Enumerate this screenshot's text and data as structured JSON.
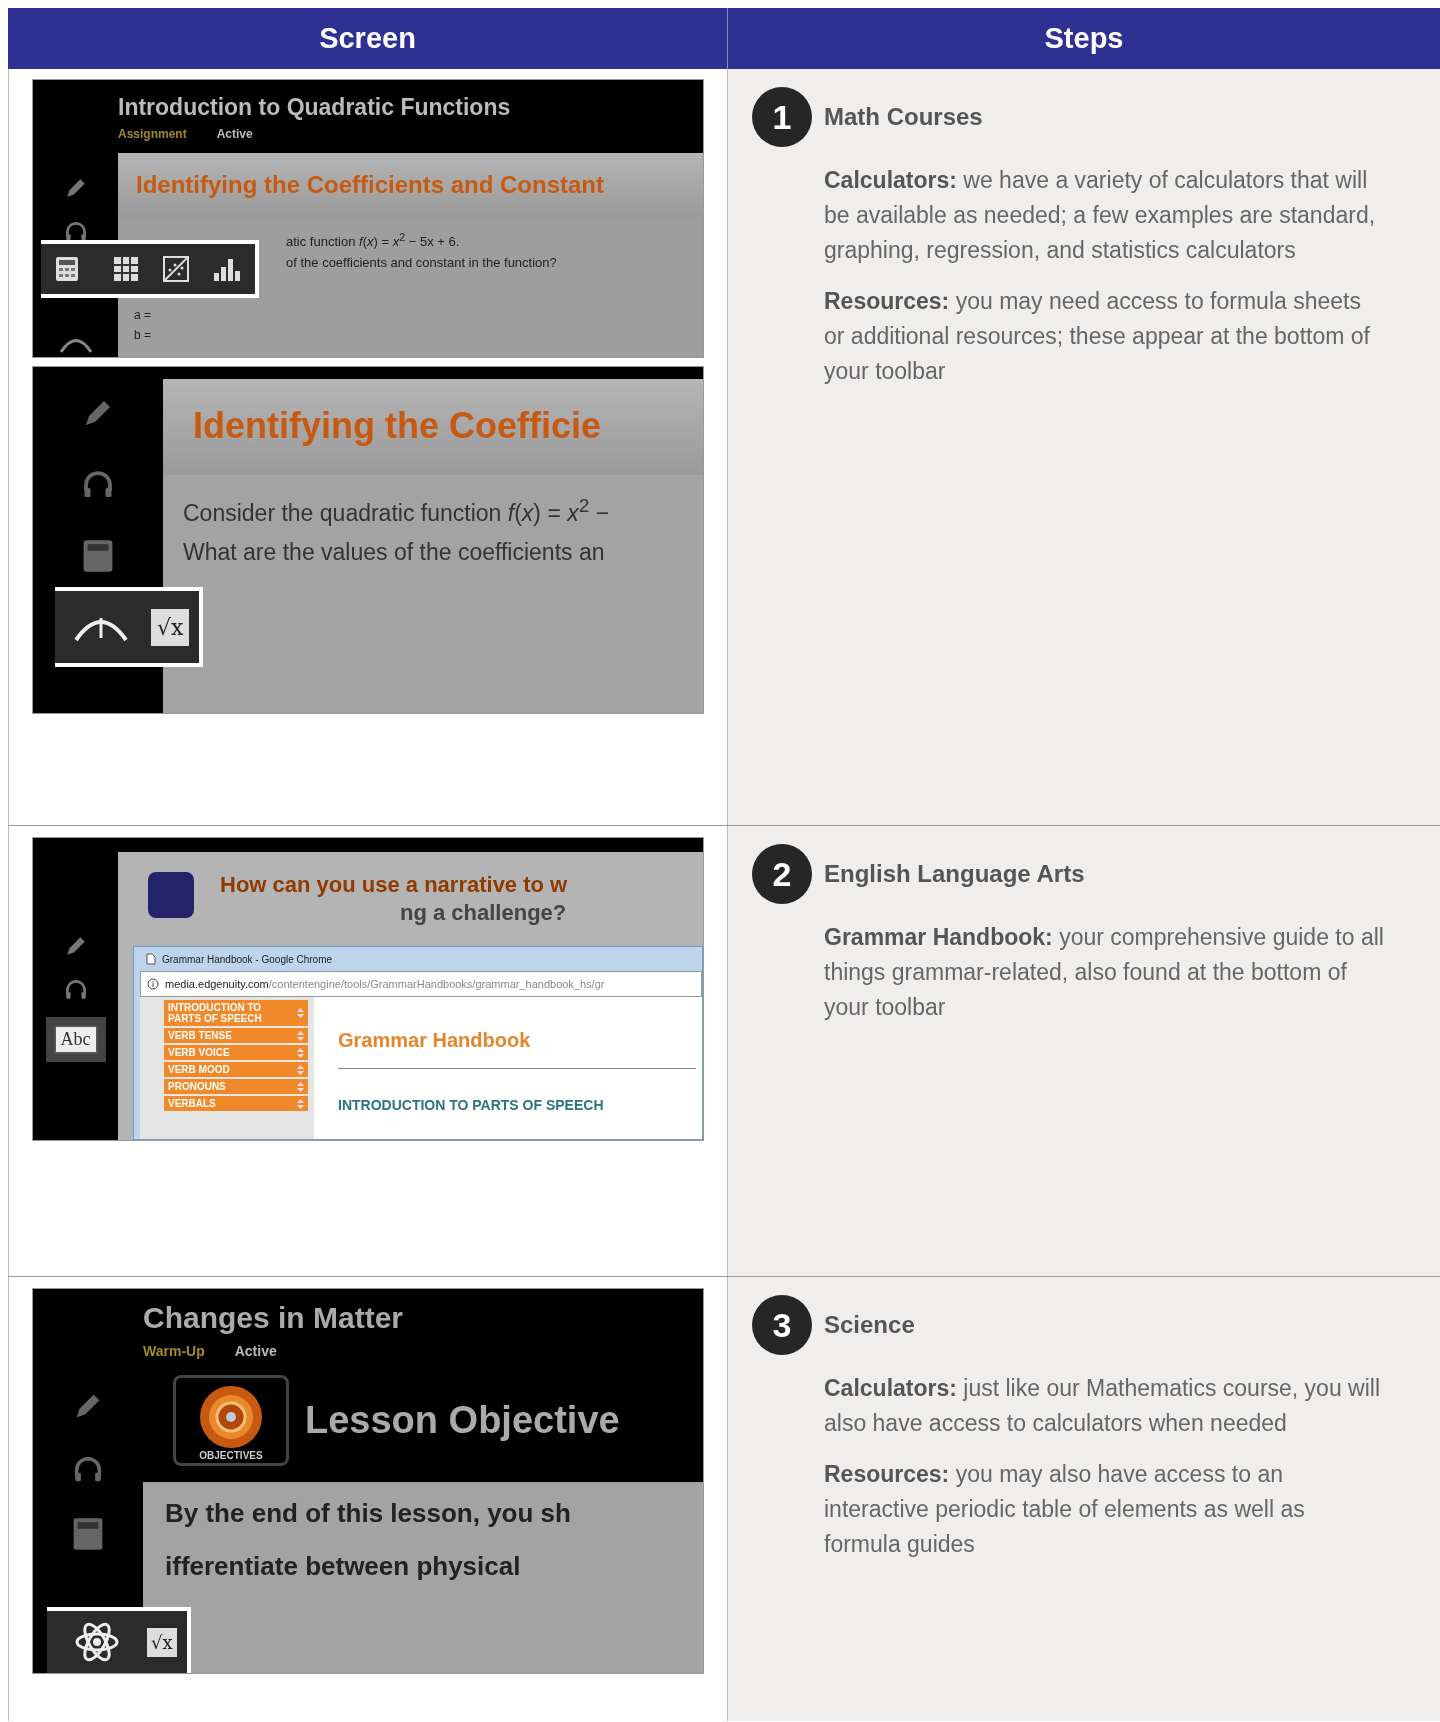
{
  "table": {
    "columns": [
      "Screen",
      "Steps"
    ],
    "rows": [
      {
        "screens": [
          {
            "kind": "lesson",
            "title": "Introduction to Quadratic Functions",
            "category": "Assignment",
            "status": "Active",
            "heading": "Identifying the Coefficients and Constant",
            "lines": [
              "atic function *f*(*x*) = *x*$^{2}$ − 5x + 6.",
              "of the coefficients and constant in the function?"
            ],
            "answers": [
              "a =",
              "b ="
            ]
          },
          {
            "kind": "zoom",
            "heading": "Identifying the Coefficie",
            "lines": [
              "Consider the quadratic function *f*(*x*) = *x*$^{2}$ −",
              "What are the values of the coefficients an"
            ],
            "tool_glyph": "√x"
          }
        ],
        "step": {
          "number": "1",
          "title": "Math Courses",
          "paragraphs": [
            {
              "term": "Calculators:",
              "text": "we have a variety of calculators that will be available as needed; a few examples are standard, graphing, regression, and statistics calculators"
            },
            {
              "term": "Resources:",
              "text": "you may need access to formula sheets or additional resources; these appear at the bottom of your toolbar"
            }
          ]
        }
      },
      {
        "screens": [
          {
            "kind": "grammar",
            "book_glyph": "Abc",
            "question": "How can you use a narrative to w",
            "question_2": "ng a challenge?",
            "window_title": "Grammar Handbook - Google Chrome",
            "url_domain": "media.edgenuity.com",
            "url_path": "/contentengine/tools/GrammarHandbooks/grammar_handbook_hs/gr",
            "nav": [
              "INTRODUCTION TO PARTS OF SPEECH",
              "VERB TENSE",
              "VERB VOICE",
              "VERB MOOD",
              "PRONOUNS",
              "VERBALS"
            ],
            "page_title": "Grammar Handbook",
            "section_title": "INTRODUCTION TO PARTS OF SPEECH"
          }
        ],
        "step": {
          "number": "2",
          "title": "English Language Arts",
          "paragraphs": [
            {
              "term": "Grammar Handbook:",
              "text": "your comprehensive guide to all things grammar-related, also found at the bottom of your toolbar"
            }
          ]
        }
      },
      {
        "screens": [
          {
            "kind": "science",
            "title": "Changes in Matter",
            "category": "Warm-Up",
            "status": "Active",
            "badge": "OBJECTIVES",
            "heading": "Lesson Objective",
            "lines": [
              "By the end of this lesson, you sh",
              "ifferentiate between physical"
            ],
            "tool_glyph": "√x"
          }
        ],
        "step": {
          "number": "3",
          "title": "Science",
          "paragraphs": [
            {
              "term": "Calculators:",
              "text": "just like our Mathematics course, you will also have access to calculators when needed"
            },
            {
              "term": "Resources:",
              "text": "you may also have access to an interactive periodic table of elements as well as formula guides"
            }
          ]
        }
      }
    ]
  }
}
